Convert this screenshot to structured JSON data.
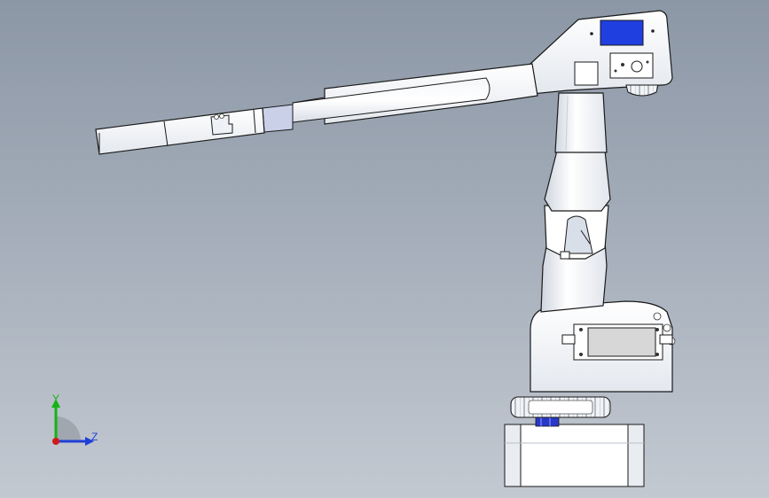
{
  "triad": {
    "y_label": "Y",
    "z_label": "Z",
    "colors": {
      "x": "#d11a1a",
      "y": "#13b313",
      "z": "#1f3fd6"
    }
  },
  "model": {
    "description_icon": "robotic-arm-model",
    "colors": {
      "part_fill": "#ffffff",
      "part_shade": "#dde2ea",
      "edge": "#1a1a1a",
      "display_screen": "#1f3fe0",
      "highlight_section": "#c9d0e8",
      "servo_body": "#d7d7d7",
      "screw_blue": "#2838c8"
    }
  },
  "background": {
    "top": "#8c97a6",
    "bottom": "#c3c9d1"
  }
}
